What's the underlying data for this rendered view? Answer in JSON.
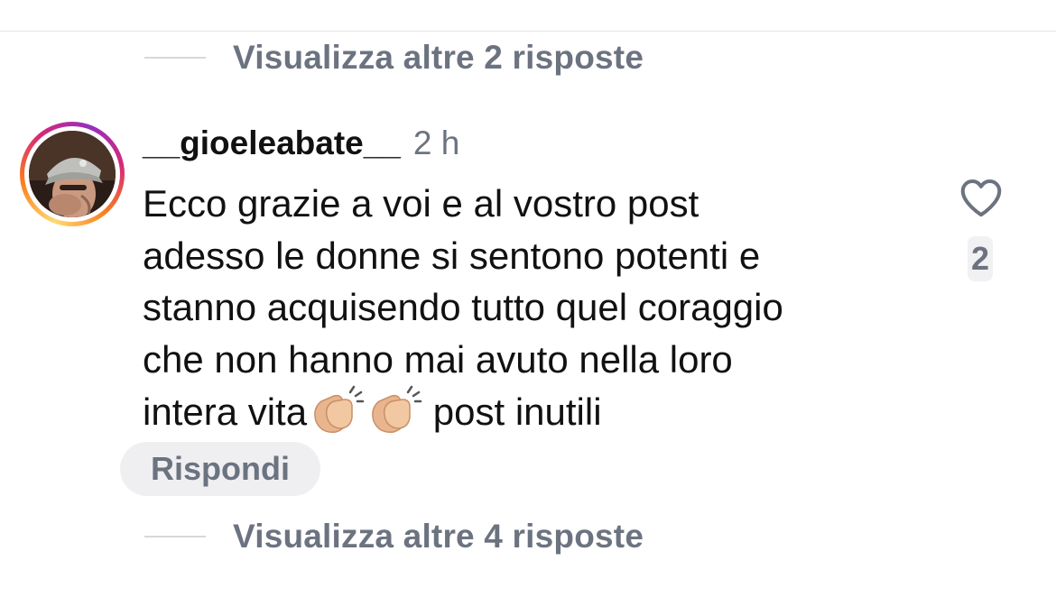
{
  "thread": {
    "view_more_top": "Visualizza altre 2 risposte",
    "view_more_bottom": "Visualizza altre 4 risposte"
  },
  "comment": {
    "username": "__gioeleabate__",
    "time": "2 h",
    "text_lines": [
      "Ecco grazie a voi e al vostro post",
      "adesso le donne si sentono potenti e",
      "stanno acquisendo tutto quel coraggio",
      "che non hanno mai avuto nella loro",
      "intera vita"
    ],
    "text_tail": "post inutili",
    "emojis": [
      "clapping-hands-emoji",
      "clapping-hands-emoji"
    ],
    "reply_label": "Rispondi",
    "like_count": "2",
    "avatar_ring_colors": [
      "#feda75",
      "#fa7e1e",
      "#d62976",
      "#962fbf"
    ]
  }
}
